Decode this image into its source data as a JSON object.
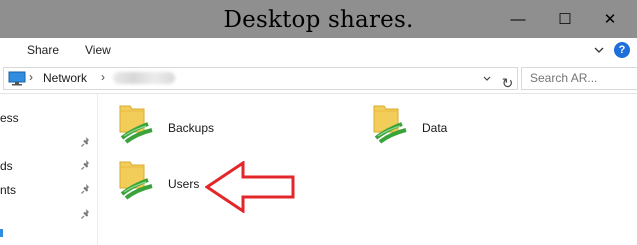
{
  "window": {
    "title": "Desktop shares.",
    "minimize_symbol": "—",
    "maximize_symbol": "☐",
    "close_symbol": "✕"
  },
  "ribbon": {
    "tabs": [
      "Share",
      "View"
    ],
    "help_label": "?"
  },
  "address": {
    "location_icon": "computer-icon",
    "separator": "›",
    "breadcrumb": [
      "Network"
    ],
    "refresh_symbol": "↻",
    "search_placeholder": "Search AR..."
  },
  "nav_pane": {
    "partial_labels": [
      "ess",
      "ds",
      "nts"
    ]
  },
  "content": {
    "items": [
      {
        "label": "Backups",
        "icon": "network-share-folder-icon"
      },
      {
        "label": "Data",
        "icon": "network-share-folder-icon"
      },
      {
        "label": "Users",
        "icon": "network-share-folder-icon"
      }
    ],
    "annotation": "red-outline-arrow-pointing-left"
  },
  "colors": {
    "title_bar": "#8f8f8f",
    "accent_red": "#e3262a",
    "folder_yellow": "#f3cd5a",
    "share_green": "#3aa33a"
  }
}
